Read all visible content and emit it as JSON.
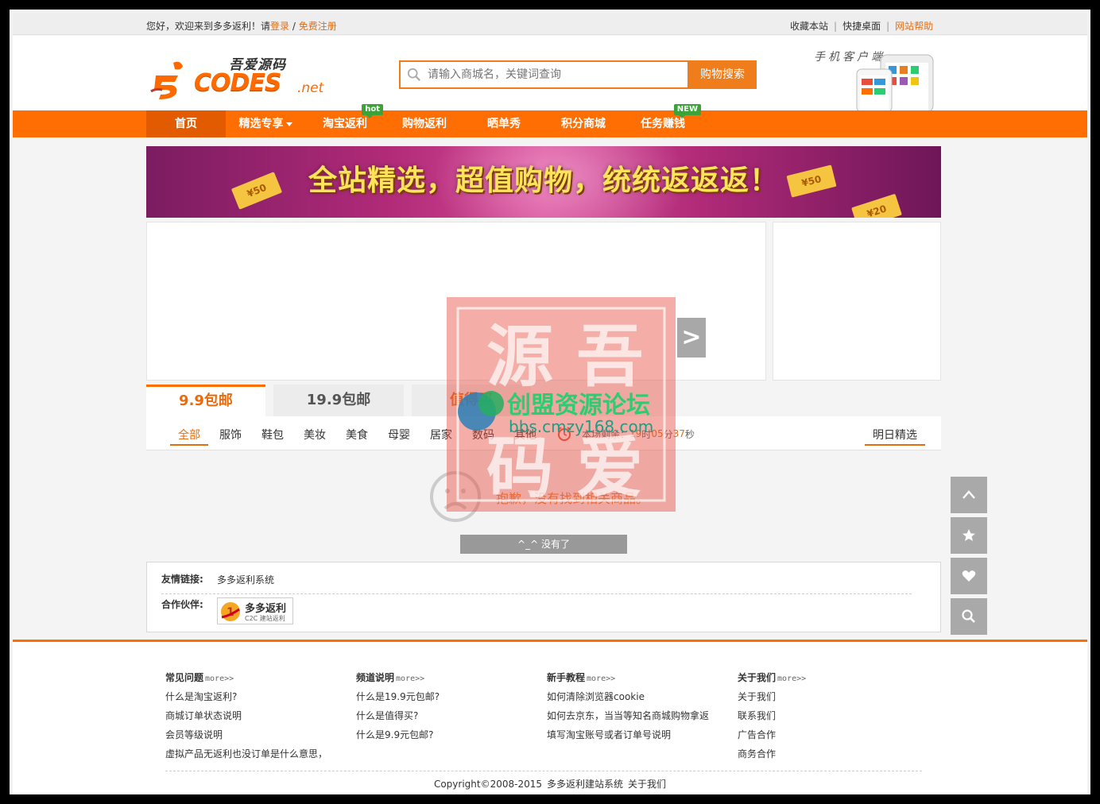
{
  "topbar": {
    "welcome": "您好，欢迎来到多多返利！请",
    "login": "登录",
    "slash": " / ",
    "register": "免费注册",
    "favorite": "收藏本站",
    "desktop": "快捷桌面",
    "help": "网站帮助"
  },
  "logo": {
    "sub": "吾爱源码",
    "main": "CODES",
    "net": ".net"
  },
  "search": {
    "placeholder": "请输入商城名，关键词查询",
    "button": "购物搜索"
  },
  "mobile": {
    "label": "手机客户端"
  },
  "nav": {
    "items": [
      {
        "label": "首页"
      },
      {
        "label": "精选专享"
      },
      {
        "label": "淘宝返利",
        "badge": "hot"
      },
      {
        "label": "购物返利"
      },
      {
        "label": "晒单秀"
      },
      {
        "label": "积分商城"
      },
      {
        "label": "任务赚钱",
        "badge": "NEW"
      }
    ]
  },
  "banner": {
    "text": "全站精选，超值购物，统统返返返！",
    "coupons": [
      "¥50",
      "¥50",
      "¥20"
    ]
  },
  "slider": {
    "next": ">"
  },
  "tabs": [
    "9.9包邮",
    "19.9包邮",
    "值得买"
  ],
  "categories": [
    "全部",
    "服饰",
    "鞋包",
    "美妆",
    "美食",
    "母婴",
    "居家",
    "数码",
    "其他"
  ],
  "timer": {
    "prefix": "本场剩余：",
    "h": "19",
    "hu": "时",
    "m": "05",
    "mu": "分",
    "s": "37",
    "su": "秒"
  },
  "tomorrow": "明日精选",
  "empty": {
    "message": "抱歉，没有找到相关商品。"
  },
  "nomore": "^_^ 没有了",
  "links": {
    "friend_label": "友情链接:",
    "friend_value": "多多返利系统",
    "partner_label": "合作伙伴:",
    "partner_name": "多多返利",
    "partner_sub": "C2C 建站返利"
  },
  "footer": {
    "cols": [
      {
        "title": "常见问题",
        "more": "more>>",
        "items": [
          "什么是淘宝返利?",
          "商城订单状态说明",
          "会员等级说明",
          "虚拟产品无返利也没订单是什么意思，"
        ]
      },
      {
        "title": "频道说明",
        "more": "more>>",
        "items": [
          "什么是19.9元包邮?",
          "什么是值得买?",
          "什么是9.9元包邮?"
        ]
      },
      {
        "title": "新手教程",
        "more": "more>>",
        "items": [
          "如何清除浏览器cookie",
          "如何去京东，当当等知名商城购物拿返",
          "填写淘宝账号或者订单号说明"
        ]
      },
      {
        "title": "关于我们",
        "more": "more>>",
        "items": [
          "关于我们",
          "联系我们",
          "广告合作",
          "商务合作"
        ]
      }
    ],
    "copyright": "Copyright©2008-2015",
    "system": "多多返利建站系统",
    "about": "关于我们"
  },
  "watermark": {
    "line1": "源 吾",
    "line2": "码 爱",
    "title": "创盟资源论坛",
    "url": "bbs.cmzy168.com"
  },
  "colors": {
    "accent": "#ff6e03",
    "link": "#e86c0e",
    "badge": "#3da23a"
  }
}
